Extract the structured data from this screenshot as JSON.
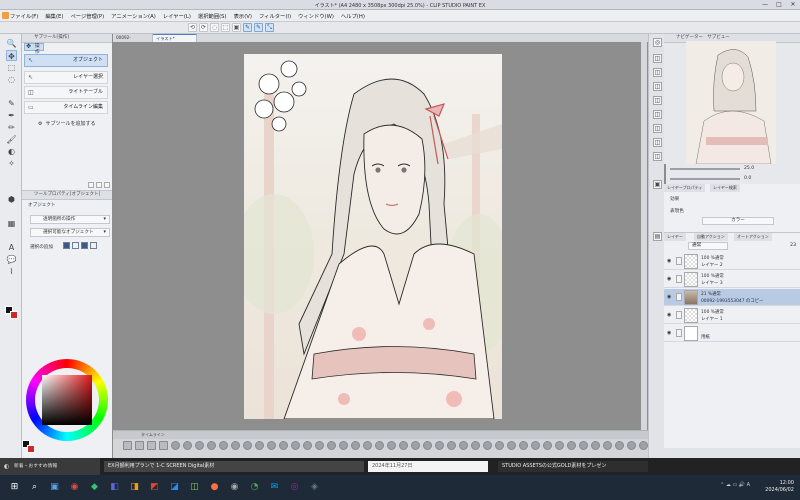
{
  "window": {
    "title": "イラスト* (A4 2480 x 3508px 300dpi 25.0%) - CLIP STUDIO PAINT EX",
    "controls": [
      "—",
      "□",
      "✕"
    ]
  },
  "menu": [
    "ファイル(F)",
    "編集(E)",
    "ページ管理(P)",
    "アニメーション(A)",
    "レイヤー(L)",
    "選択範囲(S)",
    "表示(V)",
    "フィルター(I)",
    "ウィンドウ(W)",
    "ヘルプ(H)"
  ],
  "command_bar": [
    "⟲",
    "⟳",
    "◌",
    "⬚",
    "▣",
    "✎",
    "✎",
    "⤡"
  ],
  "tools": [
    "🔍",
    "✥",
    "⬚",
    "◌",
    "✎",
    "✒",
    "✏",
    "🖌",
    "◐",
    "✧",
    "⬢",
    "▦",
    "A",
    "💬",
    "⌇"
  ],
  "sub_tool": {
    "header": "サブツール[操作]",
    "active_group": "操作",
    "items": [
      {
        "label": "オブジェクト",
        "icon": "↖",
        "selected": true
      },
      {
        "label": "レイヤー選択",
        "icon": "↖",
        "selected": false
      },
      {
        "label": "ライトテーブル",
        "icon": "◫",
        "selected": false
      },
      {
        "label": "タイムライン編集",
        "icon": "▭",
        "selected": false
      }
    ],
    "add_label": "サブツールを追加する"
  },
  "tool_property": {
    "header": "ツールプロパティ[オブジェクト]",
    "name": "オブジェクト",
    "fields": [
      "透明箇所の操作",
      "選択可能なオブジェクト"
    ],
    "select_label": "選択の追加"
  },
  "doc_tabs": [
    "00092-1993553...",
    "イラスト*"
  ],
  "timeline": {
    "header": "タイムライン"
  },
  "navigator": {
    "tabs": [
      "ナビゲーター",
      "サブビュー"
    ],
    "zoom": "25.0",
    "angle": "0.0"
  },
  "layer_property": {
    "tabs": [
      "レイヤープロパティ",
      "レイヤー検索"
    ],
    "effect_label": "効果",
    "expression_label": "表現色",
    "expression_value": "カラー"
  },
  "layer_panel": {
    "tabs": [
      "レイヤー",
      "自動アクション",
      "オートアクション"
    ],
    "blend_mode": "通常",
    "opacity": "23",
    "layers": [
      {
        "opacity": "100 %通常",
        "name": "レイヤー 2",
        "selected": false,
        "thumb": "clear"
      },
      {
        "opacity": "100 %通常",
        "name": "レイヤー 3",
        "selected": false,
        "thumb": "clear"
      },
      {
        "opacity": "21 %通常",
        "name": "00092-1993553047 のコピー",
        "selected": true,
        "thumb": "img"
      },
      {
        "opacity": "100 %通常",
        "name": "レイヤー 1",
        "selected": false,
        "thumb": "clear"
      },
      {
        "opacity": "",
        "name": "用紙",
        "selected": false,
        "thumb": "white"
      }
    ]
  },
  "notifications": {
    "news_label": "新着・おすすめ情報",
    "banner1": "EX月額利用プランで 1-C SCREEN Digital素材",
    "banner2": "2024年11月27日",
    "banner3": "STUDIO ASSETSの公式GOLD素材をプレゼン"
  },
  "taskbar": {
    "icons": [
      "⊞",
      "⌕",
      "▣",
      "◉",
      "◆",
      "◧",
      "◨",
      "◩",
      "◪",
      "◫",
      "●",
      "◉",
      "◔",
      "✉",
      "◎",
      "◈"
    ],
    "tray": "⌃ ☁ ▭ 🔊 A",
    "time": "12:00",
    "date": "2024/06/02"
  },
  "colors": {
    "accent": "#4a7fc5",
    "selected_layer": "#b9cbe4",
    "fg": "#111111",
    "bg": "#d02828"
  }
}
